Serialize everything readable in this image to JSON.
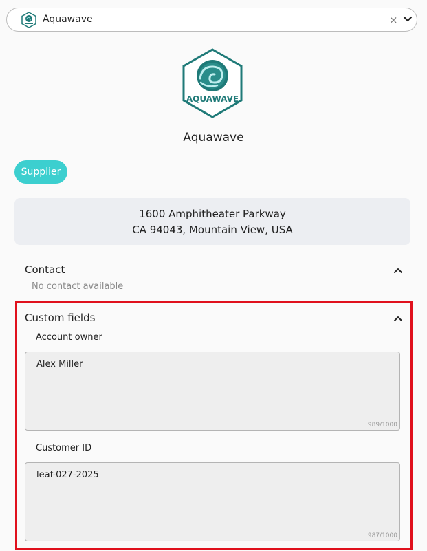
{
  "selector": {
    "value": "Aquawave",
    "clear_icon": "×"
  },
  "company": {
    "name": "Aquawave",
    "logo_text": "AQUAWAVE",
    "type_badge": "Supplier",
    "address_line1": "1600 Amphitheater Parkway",
    "address_line2": "CA 94043, Mountain View, USA"
  },
  "contact": {
    "title": "Contact",
    "empty_text": "No contact available"
  },
  "custom_fields": {
    "title": "Custom fields",
    "fields": [
      {
        "label": "Account owner",
        "value": "Alex Miller",
        "counter": "989/1000"
      },
      {
        "label": "Customer ID",
        "value": "leaf-027-2025",
        "counter": "987/1000"
      }
    ]
  },
  "colors": {
    "badge": "#3ccfcf",
    "logo_teal": "#1f7a78",
    "highlight": "#e0111d"
  },
  "icons": [
    "aquawave-logo-icon",
    "close-icon",
    "chevron-down-icon",
    "chevron-up-icon"
  ]
}
